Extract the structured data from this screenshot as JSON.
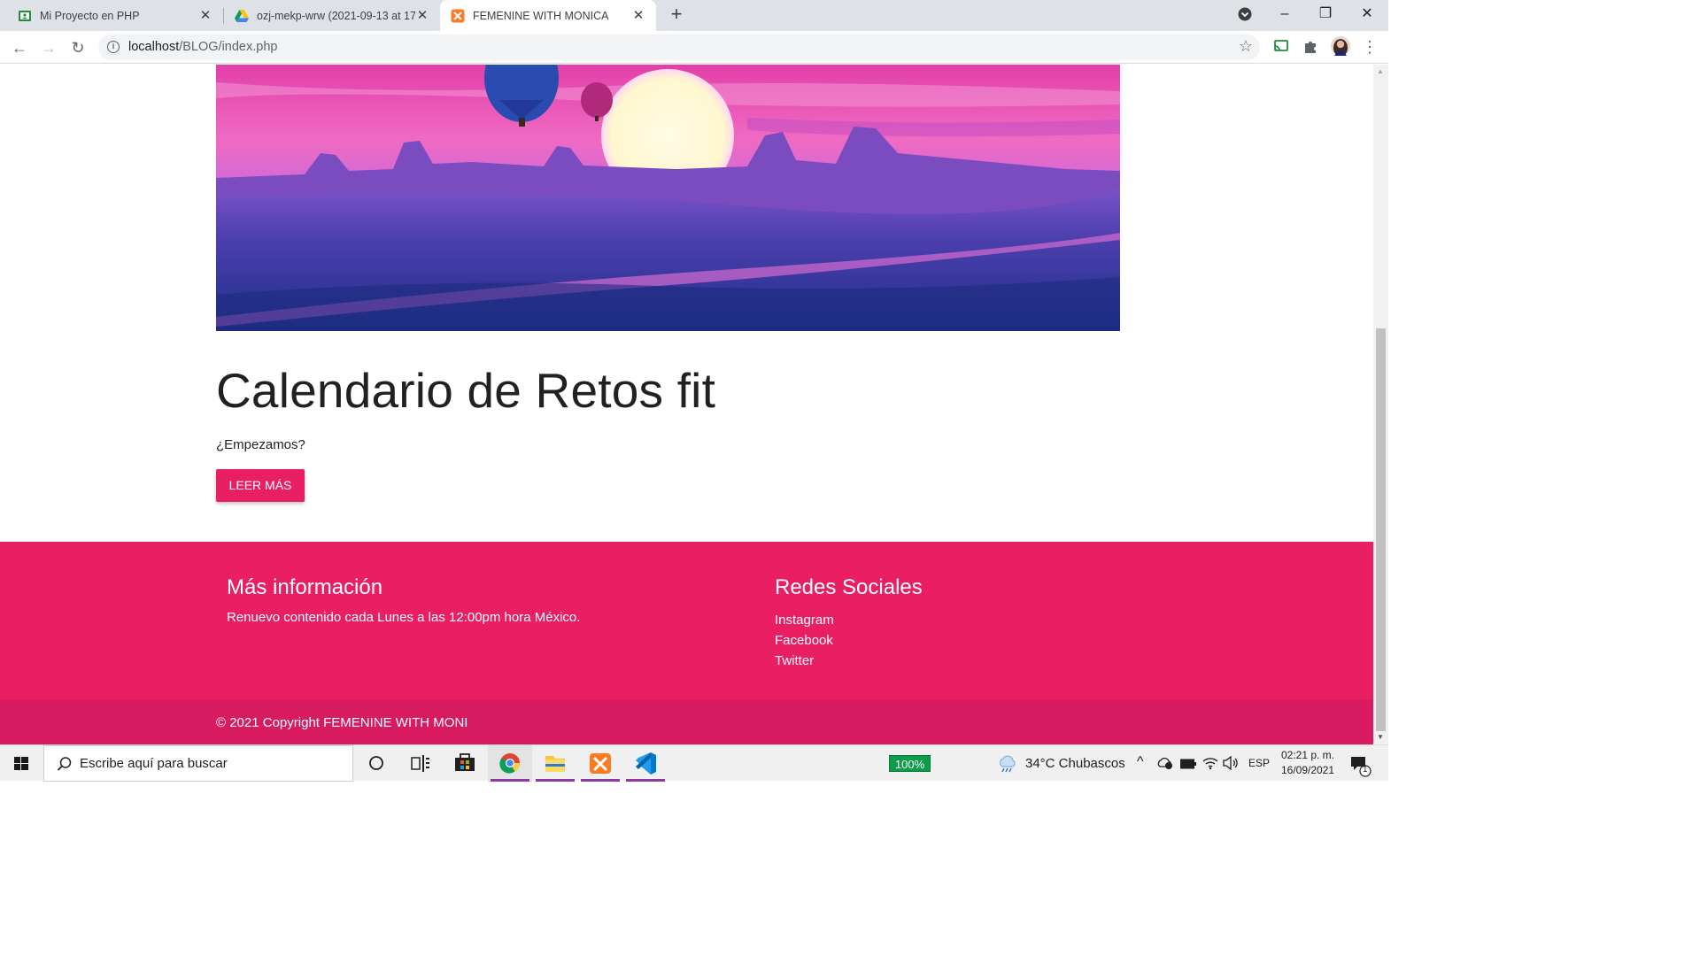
{
  "browser": {
    "tabs": [
      {
        "title": "Mi Proyecto en PHP",
        "icon": "classroom-icon",
        "active": false
      },
      {
        "title": "ozj-mekp-wrw (2021-09-13 at 17",
        "icon": "google-drive-icon",
        "active": false
      },
      {
        "title": "FEMENINE WITH MONICA",
        "icon": "xampp-icon",
        "active": true
      }
    ],
    "url_host": "localhost",
    "url_path": "/BLOG/index.php"
  },
  "page": {
    "post": {
      "title": "Calendario de Retos fit",
      "subtitle": "¿Empezamos?",
      "button_label": "LEER MÁS"
    },
    "footer": {
      "info_heading": "Más información",
      "info_text": "Renuevo contenido cada Lunes a las 12:00pm hora México.",
      "social_heading": "Redes Sociales",
      "social_links": [
        "Instagram",
        "Facebook",
        "Twitter"
      ]
    },
    "copyright": "© 2021 Copyright FEMENINE WITH MONI",
    "colors": {
      "accent": "#e91e63",
      "copyright_bg": "#d81b60"
    }
  },
  "taskbar": {
    "search_placeholder": "Escribe aquí para buscar",
    "battery": "100%",
    "weather": "34°C  Chubascos",
    "language": "ESP",
    "time": "02:21 p. m.",
    "date": "16/09/2021",
    "notification_count": "1"
  }
}
